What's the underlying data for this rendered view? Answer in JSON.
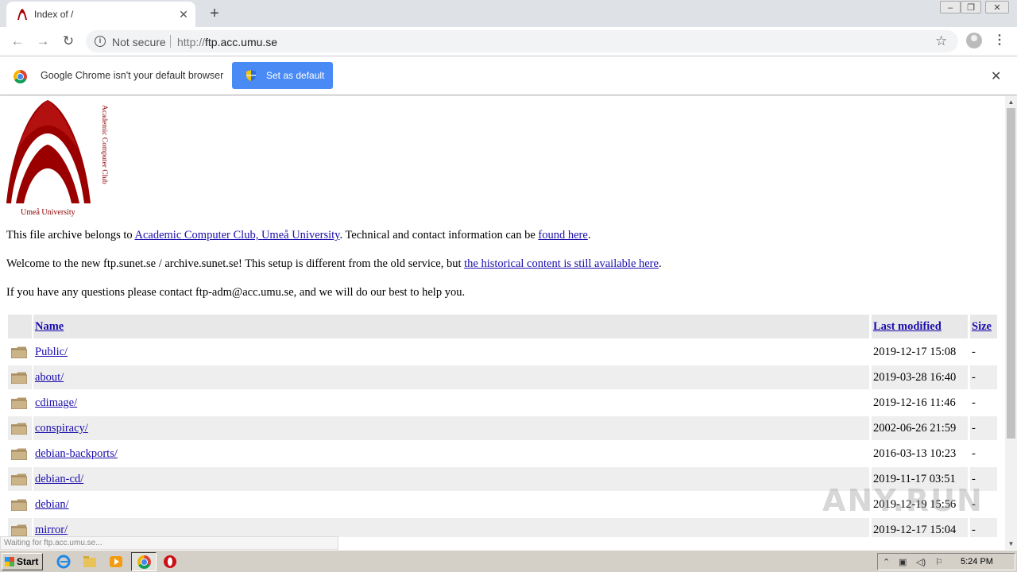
{
  "browser": {
    "tab_title": "Index of /",
    "not_secure_label": "Not secure",
    "url_scheme": "http://",
    "url_host": "ftp.acc.umu.se"
  },
  "infobar": {
    "message": "Google Chrome isn't your default browser",
    "button_label": "Set as default"
  },
  "page": {
    "logo_vertical_text": "Academic Computer Club",
    "logo_caption": "Umeå University",
    "p1_before": "This file archive belongs to ",
    "p1_link": "Academic Computer Club, Umeå University",
    "p1_middle": ". Technical and contact information can be ",
    "p1_link2": "found here",
    "p1_after": ".",
    "p2_before": "Welcome to the new ftp.sunet.se / archive.sunet.se! This setup is different from the old service, but ",
    "p2_link": "the historical content is still available here",
    "p2_after": ".",
    "p3": "If you have any questions please contact ftp-adm@acc.umu.se, and we will do our best to help you."
  },
  "listing": {
    "headers": {
      "name": "Name",
      "modified": "Last modified",
      "size": "Size"
    },
    "rows": [
      {
        "name": "Public/",
        "modified": "2019-12-17 15:08",
        "size": "-"
      },
      {
        "name": "about/",
        "modified": "2019-03-28 16:40",
        "size": "-"
      },
      {
        "name": "cdimage/",
        "modified": "2019-12-16 11:46",
        "size": "-"
      },
      {
        "name": "conspiracy/",
        "modified": "2002-06-26 21:59",
        "size": "-"
      },
      {
        "name": "debian-backports/",
        "modified": "2016-03-13 10:23",
        "size": "-"
      },
      {
        "name": "debian-cd/",
        "modified": "2019-11-17 03:51",
        "size": "-"
      },
      {
        "name": "debian/",
        "modified": "2019-12-19 15:56",
        "size": "-"
      },
      {
        "name": "mirror/",
        "modified": "2019-12-17 15:04",
        "size": "-"
      }
    ]
  },
  "status": {
    "text": "Waiting for ftp.acc.umu.se..."
  },
  "watermark": "ANY.RUN",
  "taskbar": {
    "start_label": "Start",
    "clock": "5:24 PM"
  },
  "colors": {
    "logo": "#8b0000",
    "link": "#1a0dab",
    "button": "#4a8af4"
  }
}
